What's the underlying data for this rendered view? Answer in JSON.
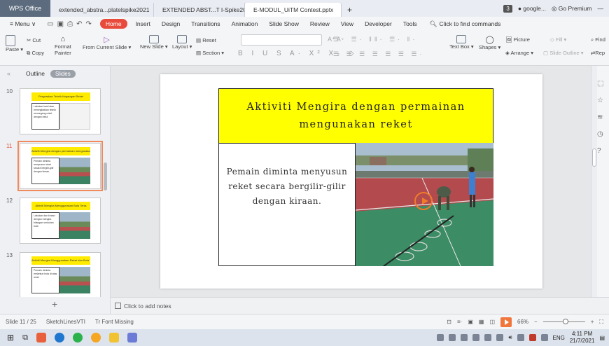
{
  "titlebar": {
    "app_button": "WPS Office",
    "tabs": [
      {
        "label": "extended_abstra...platelspike2021",
        "type": "w",
        "active": false
      },
      {
        "label": "EXTENDED ABST...T I-Spike2021",
        "type": "w",
        "active": false
      },
      {
        "label": "E-MODUL_UiTM Contest.pptx",
        "type": "p",
        "active": true
      }
    ],
    "new_tab": "+",
    "badge": "3",
    "account": "google...",
    "premium": "Go Premium",
    "minimize": "—"
  },
  "menu": {
    "menu_label": "Menu",
    "items": [
      "Home",
      "Insert",
      "Design",
      "Transitions",
      "Animation",
      "Slide Show",
      "Review",
      "View",
      "Developer",
      "Tools"
    ],
    "search_placeholder": "Click to find commands"
  },
  "ribbon": {
    "paste": "Paste",
    "cut": "Cut",
    "copy": "Copy",
    "format_painter_1": "Format",
    "format_painter_2": "Painter",
    "from_current_slide": "From Current Slide",
    "new_slide": "New Slide",
    "layout": "Layout",
    "reset": "Reset",
    "section": "Section",
    "text_box": "Text Box",
    "shapes": "Shapes",
    "picture": "Picture",
    "fill": "Fill",
    "arrange": "Arrange",
    "slide_outline": "Slide Outline",
    "find": "Find",
    "replace": "Rep"
  },
  "left_panel": {
    "outline_tab": "Outline",
    "slides_tab": "Slides",
    "thumbnails": [
      {
        "num": "10",
        "title": "Pergerakan Teknik Kegangan Reket",
        "text": "Lakukan hasil atau meningkatkan teknik memegang reket dengan betul",
        "img": "sketch",
        "selected": false
      },
      {
        "num": "11",
        "title": "Aktiviti Mengira dengan permainan mengunakan reket",
        "text": "Pemain diminta menyusun reket secara bergilir-gilir dengan kiraan.",
        "img": "photo",
        "selected": true
      },
      {
        "num": "12",
        "title": "Aktiviti Mengira Menggunakan Bola Tenis",
        "text": "Lakukan dan kiraan dengan mengira bilangan sentuhan bola",
        "img": "photo",
        "selected": false
      },
      {
        "num": "13",
        "title": "Aktiviti Mengira Menggunakan Reket dan Bola Tenis",
        "text": "Pemain diminta melantun bola di atas reket",
        "img": "photo",
        "selected": false
      }
    ],
    "add_slide": "+"
  },
  "slide": {
    "title": "Aktiviti Mengira dengan permainan mengunakan reket",
    "body": "Pemain diminta menyusun reket secara bergilir-gilir dengan kiraan.",
    "colors": {
      "title_bg": "#ffff00",
      "court_red": "#b24a4e",
      "court_green": "#3c8c65"
    }
  },
  "notes": {
    "placeholder": "Click to add notes"
  },
  "statusbar": {
    "slide_counter": "Slide 11 / 25",
    "theme": "SketchLinesVTI",
    "font_missing": "Font Missing",
    "zoom": "66%",
    "zoom_minus": "−",
    "zoom_plus": "+"
  },
  "taskbar": {
    "lang": "ENG",
    "time": "4:11 PM",
    "date": "21/7/2021"
  }
}
